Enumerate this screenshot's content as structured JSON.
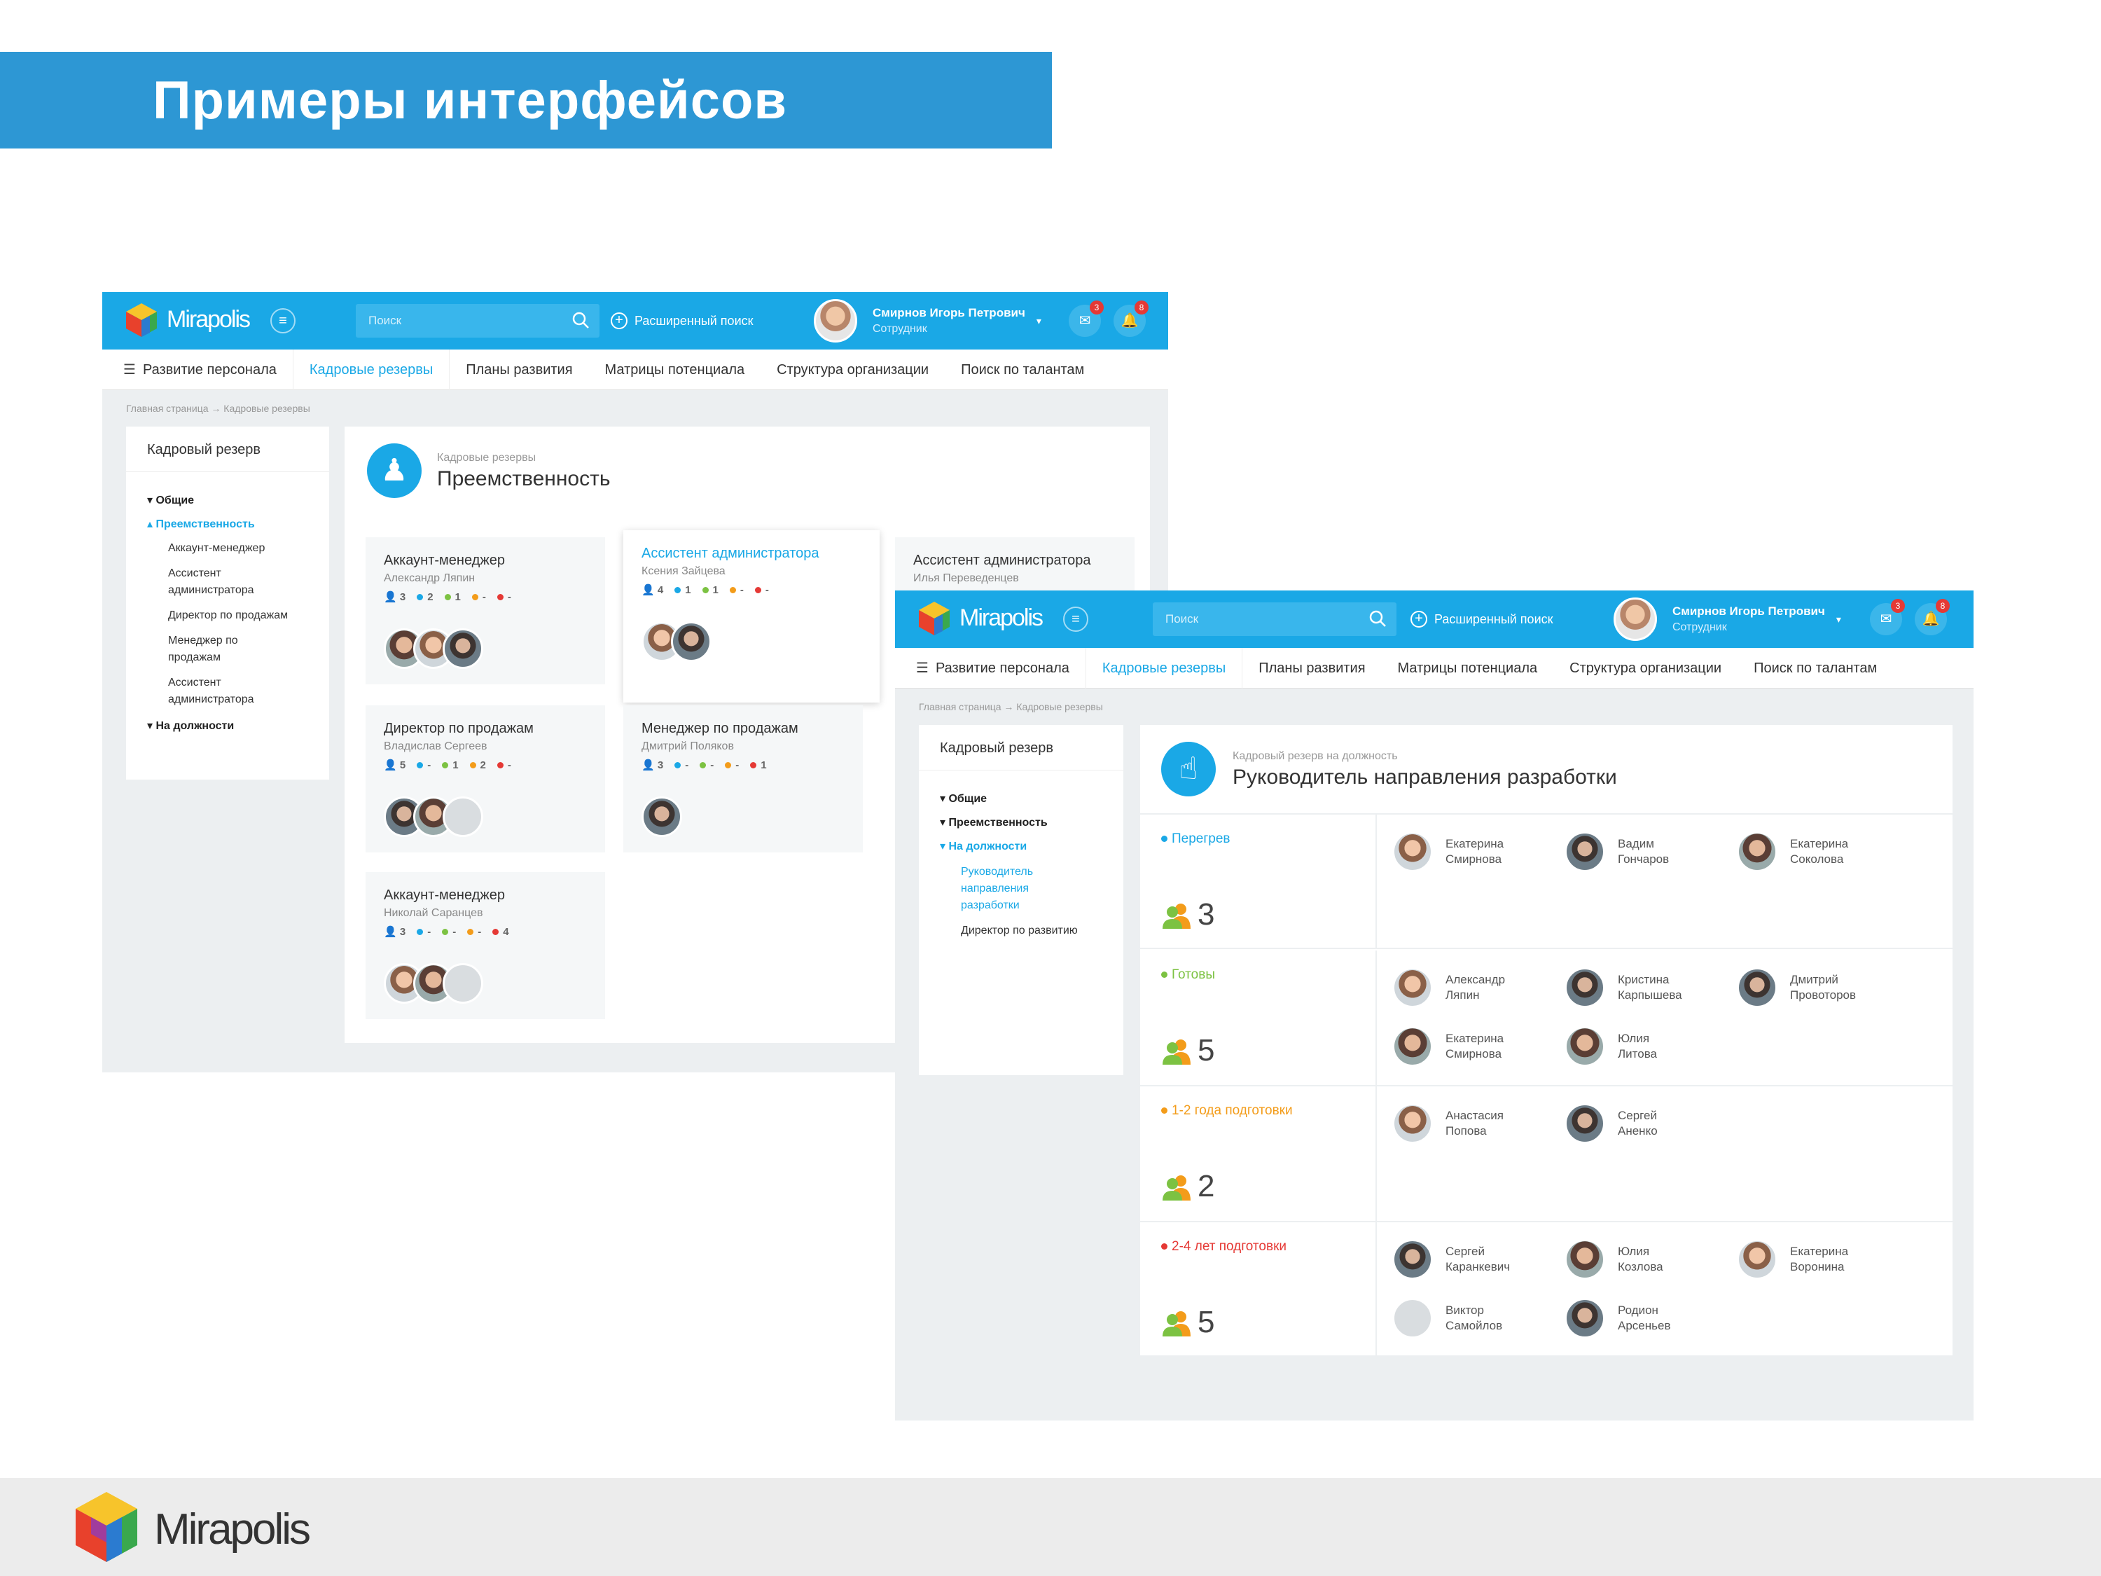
{
  "slide": {
    "title": "Примеры интерфейсов",
    "footer_brand": "Mirapolis"
  },
  "app": {
    "brand": "Mirapolis",
    "search_placeholder": "Поиск",
    "advanced_search": "Расширенный поиск",
    "user_name": "Смирнов Игорь Петрович",
    "user_role": "Сотрудник",
    "mail_count": "3",
    "notif_count": "8",
    "nav": [
      "Развитие персонала",
      "Кадровые резервы",
      "Планы развития",
      "Матрицы потенциала",
      "Структура организации",
      "Поиск по талантам"
    ],
    "breadcrumb": "Главная страница → Кадровые резервы",
    "sidebar_title": "Кадровый резерв"
  },
  "window1": {
    "sidebar": {
      "general": "Общие",
      "succession": "Преемственность",
      "items": [
        "Аккаунт-менеджер",
        "Ассистент администратора",
        "Директор по продажам",
        "Менеджер по продажам",
        "Ассистент администратора"
      ],
      "positions": "На должности"
    },
    "header_sub": "Кадровые резервы",
    "header_title": "Преемственность",
    "cards": [
      {
        "title": "Аккаунт-менеджер",
        "name": "Александр Ляпин",
        "p": "3",
        "b": "2",
        "g": "1",
        "o": "-",
        "r": "-"
      },
      {
        "title": "Ассистент администратора",
        "name": "Ксения Зайцева",
        "p": "4",
        "b": "1",
        "g": "1",
        "o": "-",
        "r": "-"
      },
      {
        "title": "Ассистент администратора",
        "name": "Илья Переведенцев"
      },
      {
        "title": "Директор по продажам",
        "name": "Владислав Сергеев",
        "p": "5",
        "b": "-",
        "g": "1",
        "o": "2",
        "r": "-"
      },
      {
        "title": "Менеджер по продажам",
        "name": "Дмитрий Поляков",
        "p": "3",
        "b": "-",
        "g": "-",
        "o": "-",
        "r": "1"
      },
      {
        "title": "Аккаунт-менеджер",
        "name": "Николай Саранцев",
        "p": "3",
        "b": "-",
        "g": "-",
        "o": "-",
        "r": "4"
      }
    ]
  },
  "window2": {
    "sidebar": {
      "general": "Общие",
      "succession": "Преемственность",
      "positions": "На должности",
      "item_active": "Руководитель направления разработки",
      "item_other": "Директор по развитию"
    },
    "header_sub": "Кадровый резерв на должность",
    "header_title": "Руководитель направления разработки",
    "rows": [
      {
        "label": "Перегрев",
        "color": "#1aa8e6",
        "count": "3",
        "people": [
          "Екатерина Смирнова",
          "Вадим Гончаров",
          "Екатерина Соколова"
        ]
      },
      {
        "label": "Готовы",
        "color": "#7cc242",
        "count": "5",
        "people": [
          "Александр Ляпин",
          "Кристина Карпышева",
          "Дмитрий Провоторов",
          "Екатерина Смирнова",
          "Юлия Литова"
        ]
      },
      {
        "label": "1-2 года подготовки",
        "color": "#f39c1a",
        "count": "2",
        "people": [
          "Анастасия Попова",
          "Сергей Аненко"
        ]
      },
      {
        "label": "2-4 лет подготовки",
        "color": "#e53935",
        "count": "5",
        "people": [
          "Сергей Каранкевич",
          "Юлия Козлова",
          "Екатерина Воронина",
          "Виктор Самойлов",
          "Родион Арсеньев"
        ]
      }
    ]
  },
  "colors": {
    "accent": "#1aa8e6",
    "banner": "#2d97d4",
    "green": "#7cc242",
    "orange": "#f39c1a",
    "red": "#e53935"
  }
}
